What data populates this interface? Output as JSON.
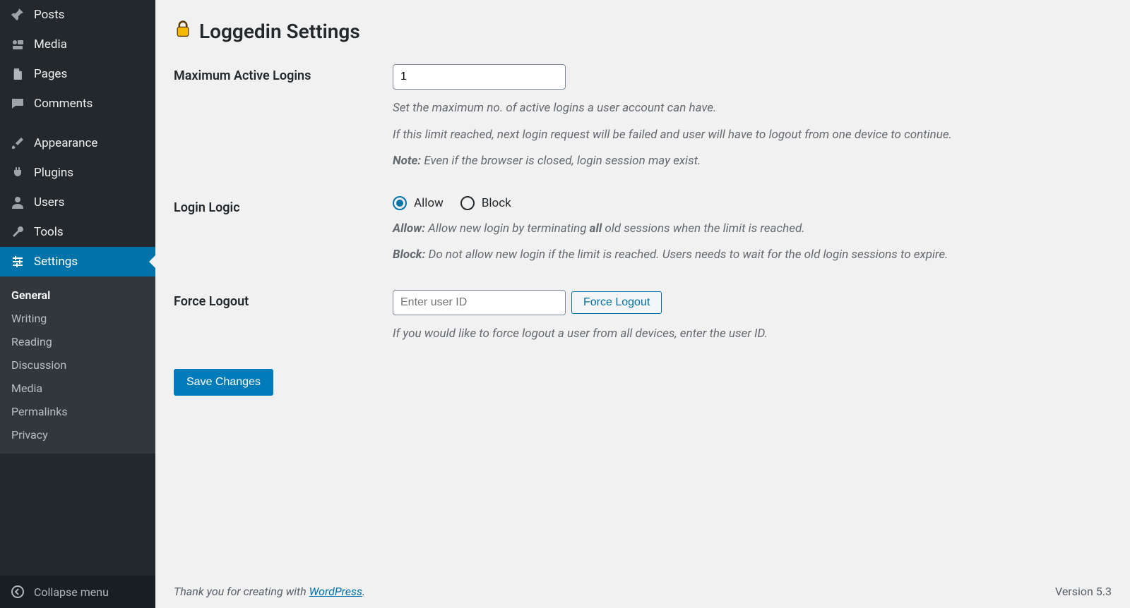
{
  "sidebar": {
    "items": [
      {
        "id": "posts",
        "label": "Posts"
      },
      {
        "id": "media",
        "label": "Media"
      },
      {
        "id": "pages",
        "label": "Pages"
      },
      {
        "id": "comments",
        "label": "Comments"
      },
      {
        "id": "appearance",
        "label": "Appearance"
      },
      {
        "id": "plugins",
        "label": "Plugins"
      },
      {
        "id": "users",
        "label": "Users"
      },
      {
        "id": "tools",
        "label": "Tools"
      },
      {
        "id": "settings",
        "label": "Settings"
      }
    ],
    "submenu": [
      "General",
      "Writing",
      "Reading",
      "Discussion",
      "Media",
      "Permalinks",
      "Privacy"
    ],
    "collapse_label": "Collapse menu"
  },
  "page": {
    "title": "Loggedin Settings"
  },
  "max_logins": {
    "label": "Maximum Active Logins",
    "value": "1",
    "help1": "Set the maximum no. of active logins a user account can have.",
    "help2": "If this limit reached, next login request will be failed and user will have to logout from one device to continue.",
    "note_label": "Note:",
    "note_text": " Even if the browser is closed, login session may exist."
  },
  "login_logic": {
    "label": "Login Logic",
    "allow_label": "Allow",
    "block_label": "Block",
    "selected": "allow",
    "allow_bold": "Allow:",
    "allow_text1": " Allow new login by terminating ",
    "allow_all": "all",
    "allow_text2": " old sessions when the limit is reached.",
    "block_bold": "Block:",
    "block_text": " Do not allow new login if the limit is reached. Users needs to wait for the old login sessions to expire."
  },
  "force_logout": {
    "label": "Force Logout",
    "placeholder": "Enter user ID",
    "button": "Force Logout",
    "help": "If you would like to force logout a user from all devices, enter the user ID."
  },
  "save_button": "Save Changes",
  "footer": {
    "thanks_pre": "Thank you for creating with ",
    "link": "WordPress",
    "thanks_post": ".",
    "version": "Version 5.3"
  }
}
